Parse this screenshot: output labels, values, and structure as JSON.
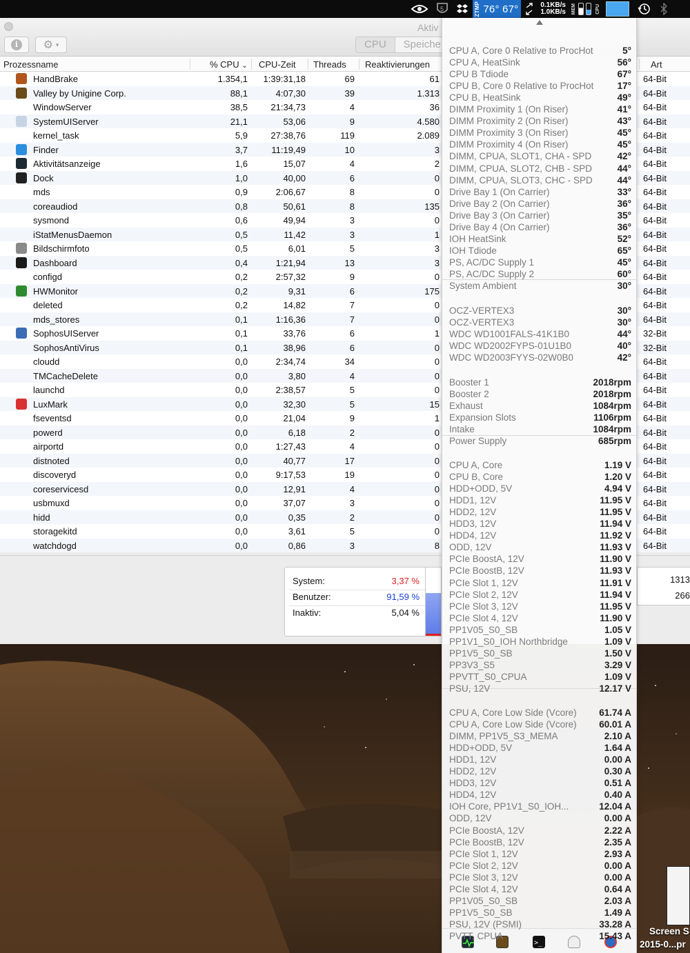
{
  "menubar": {
    "icons": [
      "nvidia-icon",
      "sophos-icon",
      "dropbox-icon"
    ],
    "temp_label": "ZTMP",
    "temp_value": "76° 67°",
    "net_up": "0.1KB/s",
    "net_down": "1.0KB/s",
    "mem_label": "MEM",
    "cpu_label": "CPU"
  },
  "window": {
    "title": "Aktiv",
    "tabs": [
      "CPU",
      "Speiche"
    ],
    "columns": {
      "name": "Prozessname",
      "cpu": "% CPU",
      "time": "CPU-Zeit",
      "threads": "Threads",
      "wakeups": "Reaktivierungen",
      "kind": "Art"
    },
    "processes": [
      {
        "name": "HandBrake",
        "cpu": "1.354,1",
        "time": "1:39:31,18",
        "threads": "69",
        "wakeups": "61",
        "kind": "64-Bit",
        "icon": "#b0561c"
      },
      {
        "name": "Valley by Unigine Corp.",
        "cpu": "88,1",
        "time": "4:07,30",
        "threads": "39",
        "wakeups": "1.313",
        "kind": "64-Bit",
        "icon": "#6a4a1a"
      },
      {
        "name": "WindowServer",
        "cpu": "38,5",
        "time": "21:34,73",
        "threads": "4",
        "wakeups": "36",
        "kind": "64-Bit",
        "icon": ""
      },
      {
        "name": "SystemUIServer",
        "cpu": "21,1",
        "time": "53,06",
        "threads": "9",
        "wakeups": "4.580",
        "kind": "64-Bit",
        "icon": "#c6d4e4"
      },
      {
        "name": "kernel_task",
        "cpu": "5,9",
        "time": "27:38,76",
        "threads": "119",
        "wakeups": "2.089",
        "kind": "64-Bit",
        "icon": ""
      },
      {
        "name": "Finder",
        "cpu": "3,7",
        "time": "11:19,49",
        "threads": "10",
        "wakeups": "3",
        "kind": "64-Bit",
        "icon": "#2d8fe0"
      },
      {
        "name": "Aktivitätsanzeige",
        "cpu": "1,6",
        "time": "15,07",
        "threads": "4",
        "wakeups": "2",
        "kind": "64-Bit",
        "icon": "#1c2b33"
      },
      {
        "name": "Dock",
        "cpu": "1,0",
        "time": "40,00",
        "threads": "6",
        "wakeups": "0",
        "kind": "64-Bit",
        "icon": "#222222"
      },
      {
        "name": "mds",
        "cpu": "0,9",
        "time": "2:06,67",
        "threads": "8",
        "wakeups": "0",
        "kind": "64-Bit",
        "icon": ""
      },
      {
        "name": "coreaudiod",
        "cpu": "0,8",
        "time": "50,61",
        "threads": "8",
        "wakeups": "135",
        "kind": "64-Bit",
        "icon": ""
      },
      {
        "name": "sysmond",
        "cpu": "0,6",
        "time": "49,94",
        "threads": "3",
        "wakeups": "0",
        "kind": "64-Bit",
        "icon": ""
      },
      {
        "name": "iStatMenusDaemon",
        "cpu": "0,5",
        "time": "11,42",
        "threads": "3",
        "wakeups": "1",
        "kind": "64-Bit",
        "icon": ""
      },
      {
        "name": "Bildschirmfoto",
        "cpu": "0,5",
        "time": "6,01",
        "threads": "5",
        "wakeups": "3",
        "kind": "64-Bit",
        "icon": "#8a8a8a"
      },
      {
        "name": "Dashboard",
        "cpu": "0,4",
        "time": "1:21,94",
        "threads": "13",
        "wakeups": "3",
        "kind": "64-Bit",
        "icon": "#1a1a1a"
      },
      {
        "name": "configd",
        "cpu": "0,2",
        "time": "2:57,32",
        "threads": "9",
        "wakeups": "0",
        "kind": "64-Bit",
        "icon": ""
      },
      {
        "name": "HWMonitor",
        "cpu": "0,2",
        "time": "9,31",
        "threads": "6",
        "wakeups": "175",
        "kind": "64-Bit",
        "icon": "#2f8a2f"
      },
      {
        "name": "deleted",
        "cpu": "0,2",
        "time": "14,82",
        "threads": "7",
        "wakeups": "0",
        "kind": "64-Bit",
        "icon": ""
      },
      {
        "name": "mds_stores",
        "cpu": "0,1",
        "time": "1:16,36",
        "threads": "7",
        "wakeups": "0",
        "kind": "64-Bit",
        "icon": ""
      },
      {
        "name": "SophosUIServer",
        "cpu": "0,1",
        "time": "33,76",
        "threads": "6",
        "wakeups": "1",
        "kind": "32-Bit",
        "icon": "#3b6cb5"
      },
      {
        "name": "SophosAntiVirus",
        "cpu": "0,1",
        "time": "38,96",
        "threads": "6",
        "wakeups": "0",
        "kind": "32-Bit",
        "icon": ""
      },
      {
        "name": "cloudd",
        "cpu": "0,0",
        "time": "2:34,74",
        "threads": "34",
        "wakeups": "0",
        "kind": "64-Bit",
        "icon": ""
      },
      {
        "name": "TMCacheDelete",
        "cpu": "0,0",
        "time": "3,80",
        "threads": "4",
        "wakeups": "0",
        "kind": "64-Bit",
        "icon": ""
      },
      {
        "name": "launchd",
        "cpu": "0,0",
        "time": "2:38,57",
        "threads": "5",
        "wakeups": "0",
        "kind": "64-Bit",
        "icon": ""
      },
      {
        "name": "LuxMark",
        "cpu": "0,0",
        "time": "32,30",
        "threads": "5",
        "wakeups": "15",
        "kind": "64-Bit",
        "icon": "#d93030"
      },
      {
        "name": "fseventsd",
        "cpu": "0,0",
        "time": "21,04",
        "threads": "9",
        "wakeups": "1",
        "kind": "64-Bit",
        "icon": ""
      },
      {
        "name": "powerd",
        "cpu": "0,0",
        "time": "6,18",
        "threads": "2",
        "wakeups": "0",
        "kind": "64-Bit",
        "icon": ""
      },
      {
        "name": "airportd",
        "cpu": "0,0",
        "time": "1:27,43",
        "threads": "4",
        "wakeups": "0",
        "kind": "64-Bit",
        "icon": ""
      },
      {
        "name": "distnoted",
        "cpu": "0,0",
        "time": "40,77",
        "threads": "17",
        "wakeups": "0",
        "kind": "64-Bit",
        "icon": ""
      },
      {
        "name": "discoveryd",
        "cpu": "0,0",
        "time": "9:17,53",
        "threads": "19",
        "wakeups": "0",
        "kind": "64-Bit",
        "icon": ""
      },
      {
        "name": "coreservicesd",
        "cpu": "0,0",
        "time": "12,91",
        "threads": "4",
        "wakeups": "0",
        "kind": "64-Bit",
        "icon": ""
      },
      {
        "name": "usbmuxd",
        "cpu": "0,0",
        "time": "37,07",
        "threads": "3",
        "wakeups": "0",
        "kind": "64-Bit",
        "icon": ""
      },
      {
        "name": "hidd",
        "cpu": "0,0",
        "time": "0,35",
        "threads": "2",
        "wakeups": "0",
        "kind": "64-Bit",
        "icon": ""
      },
      {
        "name": "storagekitd",
        "cpu": "0,0",
        "time": "3,61",
        "threads": "5",
        "wakeups": "0",
        "kind": "64-Bit",
        "icon": ""
      },
      {
        "name": "watchdogd",
        "cpu": "0,0",
        "time": "0,86",
        "threads": "3",
        "wakeups": "8",
        "kind": "64-Bit",
        "icon": ""
      }
    ],
    "stats": {
      "system_label": "System:",
      "system_value": "3,37 %",
      "user_label": "Benutzer:",
      "user_value": "91,59 %",
      "idle_label": "Inaktiv:",
      "idle_value": "5,04 %",
      "right_values": [
        "1313",
        "266"
      ]
    }
  },
  "sensors": {
    "temperatures": [
      {
        "name": "CPU A, Core 0 Relative to ProcHot",
        "value": "5°"
      },
      {
        "name": "CPU A, HeatSink",
        "value": "56°"
      },
      {
        "name": "CPU B Tdiode",
        "value": "67°"
      },
      {
        "name": "CPU B, Core 0 Relative to ProcHot",
        "value": "17°"
      },
      {
        "name": "CPU B, HeatSink",
        "value": "49°"
      },
      {
        "name": "DIMM Proximity 1 (On Riser)",
        "value": "41°"
      },
      {
        "name": "DIMM Proximity 2 (On Riser)",
        "value": "43°"
      },
      {
        "name": "DIMM Proximity 3 (On Riser)",
        "value": "45°"
      },
      {
        "name": "DIMM Proximity 4 (On Riser)",
        "value": "45°"
      },
      {
        "name": "DIMM, CPUA, SLOT1, CHA - SPD",
        "value": "42°"
      },
      {
        "name": "DIMM, CPUA, SLOT2, CHB - SPD",
        "value": "44°"
      },
      {
        "name": "DIMM, CPUA, SLOT3, CHC - SPD",
        "value": "44°"
      },
      {
        "name": "Drive Bay 1 (On Carrier)",
        "value": "33°"
      },
      {
        "name": "Drive Bay 2 (On Carrier)",
        "value": "36°"
      },
      {
        "name": "Drive Bay 3 (On Carrier)",
        "value": "35°"
      },
      {
        "name": "Drive Bay 4 (On Carrier)",
        "value": "36°"
      },
      {
        "name": "IOH HeatSink",
        "value": "52°"
      },
      {
        "name": "IOH Tdiode",
        "value": "65°"
      },
      {
        "name": "PS, AC/DC Supply 1",
        "value": "45°"
      },
      {
        "name": "PS, AC/DC Supply 2",
        "value": "60°"
      },
      {
        "name": "System Ambient",
        "value": "30°"
      }
    ],
    "drives": [
      {
        "name": "OCZ-VERTEX3",
        "value": "30°"
      },
      {
        "name": "OCZ-VERTEX3",
        "value": "30°"
      },
      {
        "name": "WDC WD1001FALS-41K1B0",
        "value": "44°"
      },
      {
        "name": "WDC WD2002FYPS-01U1B0",
        "value": "40°"
      },
      {
        "name": "WDC WD2003FYYS-02W0B0",
        "value": "42°"
      }
    ],
    "fans": [
      {
        "name": "Booster 1",
        "value": "2018rpm"
      },
      {
        "name": "Booster 2",
        "value": "2018rpm"
      },
      {
        "name": "Exhaust",
        "value": "1084rpm"
      },
      {
        "name": "Expansion Slots",
        "value": "1106rpm"
      },
      {
        "name": "Intake",
        "value": "1084rpm"
      },
      {
        "name": "Power Supply",
        "value": "685rpm"
      }
    ],
    "voltages": [
      {
        "name": "CPU A, Core",
        "value": "1.19 V"
      },
      {
        "name": "CPU B, Core",
        "value": "1.20 V"
      },
      {
        "name": "HDD+ODD, 5V",
        "value": "4.94 V"
      },
      {
        "name": "HDD1, 12V",
        "value": "11.95 V"
      },
      {
        "name": "HDD2, 12V",
        "value": "11.95 V"
      },
      {
        "name": "HDD3, 12V",
        "value": "11.94 V"
      },
      {
        "name": "HDD4, 12V",
        "value": "11.92 V"
      },
      {
        "name": "ODD, 12V",
        "value": "11.93 V"
      },
      {
        "name": "PCIe BoostA, 12V",
        "value": "11.90 V"
      },
      {
        "name": "PCIe BoostB, 12V",
        "value": "11.93 V"
      },
      {
        "name": "PCIe Slot 1, 12V",
        "value": "11.91 V"
      },
      {
        "name": "PCIe Slot 2, 12V",
        "value": "11.94 V"
      },
      {
        "name": "PCIe Slot 3, 12V",
        "value": "11.95 V"
      },
      {
        "name": "PCIe Slot 4, 12V",
        "value": "11.90 V"
      },
      {
        "name": "PP1V05_S0_SB",
        "value": "1.05 V"
      },
      {
        "name": "PP1V1_S0_IOH Northbridge",
        "value": "1.09 V"
      },
      {
        "name": "PP1V5_S0_SB",
        "value": "1.50 V"
      },
      {
        "name": "PP3V3_S5",
        "value": "3.29 V"
      },
      {
        "name": "PPVTT_S0_CPUA",
        "value": "1.09 V"
      },
      {
        "name": "PSU, 12V",
        "value": "12.17 V"
      }
    ],
    "currents": [
      {
        "name": "CPU A, Core Low Side (Vcore)",
        "value": "61.74 A"
      },
      {
        "name": "CPU A, Core Low Side (Vcore)",
        "value": "60.01 A"
      },
      {
        "name": "DIMM, PP1V5_S3_MEMA",
        "value": "2.10 A"
      },
      {
        "name": "HDD+ODD, 5V",
        "value": "1.64 A"
      },
      {
        "name": "HDD1, 12V",
        "value": "0.00 A"
      },
      {
        "name": "HDD2, 12V",
        "value": "0.30 A"
      },
      {
        "name": "HDD3, 12V",
        "value": "0.51 A"
      },
      {
        "name": "HDD4, 12V",
        "value": "0.40 A"
      },
      {
        "name": "IOH Core, PP1V1_S0_IOH...",
        "value": "12.04 A"
      },
      {
        "name": "ODD, 12V",
        "value": "0.00 A"
      },
      {
        "name": "PCIe BoostA, 12V",
        "value": "2.22 A"
      },
      {
        "name": "PCIe BoostB, 12V",
        "value": "2.35 A"
      },
      {
        "name": "PCIe Slot 1, 12V",
        "value": "2.93 A"
      },
      {
        "name": "PCIe Slot 2, 12V",
        "value": "0.00 A"
      },
      {
        "name": "PCIe Slot 3, 12V",
        "value": "0.00 A"
      },
      {
        "name": "PCIe Slot 4, 12V",
        "value": "0.64 A"
      },
      {
        "name": "PP1V05_S0_SB",
        "value": "2.03 A"
      },
      {
        "name": "PP1V5_S0_SB",
        "value": "1.49 A"
      },
      {
        "name": "PSU, 12V (PSMI)",
        "value": "33.28 A"
      },
      {
        "name": "PVTT, CPUA",
        "value": "15.43 A"
      }
    ],
    "dock_icons": [
      "activity-monitor-icon",
      "valley-icon",
      "terminal-icon",
      "system-info-icon",
      "istat-icon"
    ]
  },
  "desktop": {
    "file_label_1": "Screen S",
    "file_label_2": "2015-0...pr"
  },
  "colors": {
    "system": "#e02020",
    "user": "#1a3fd6",
    "menubar_temp": "#1f6fc8"
  }
}
